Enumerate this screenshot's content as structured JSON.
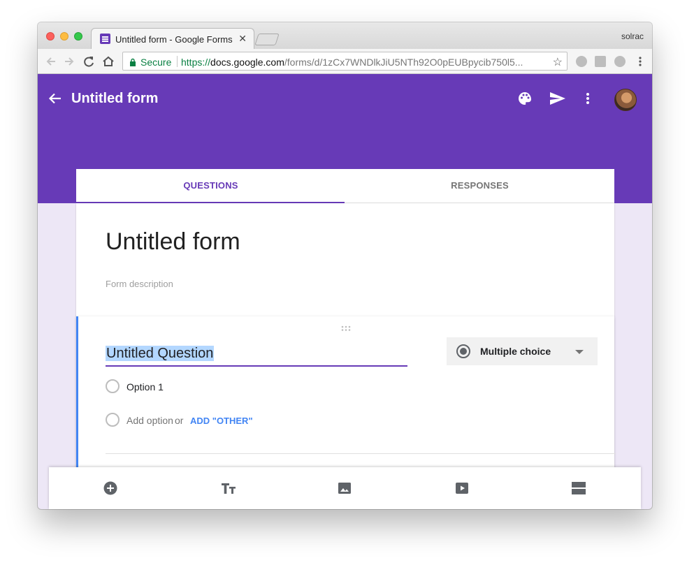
{
  "browser": {
    "tab_title": "Untitled form - Google Forms",
    "tab_close": "✕",
    "profile_name": "solrac",
    "secure_label": "Secure",
    "url_scheme": "https://",
    "url_host": "docs.google.com",
    "url_path": "/forms/d/1zCx7WNDlkJiU5NTh92O0pEUBpycib750l5..."
  },
  "header": {
    "form_title": "Untitled form",
    "icons": [
      "back-arrow-icon",
      "palette-icon",
      "send-icon",
      "more-vert-icon",
      "avatar"
    ],
    "brand_color": "#673ab7"
  },
  "tabs": [
    {
      "label": "QUESTIONS",
      "active": true
    },
    {
      "label": "RESPONSES",
      "active": false
    }
  ],
  "form": {
    "title": "Untitled form",
    "description_placeholder": "Form description"
  },
  "question": {
    "title": "Untitled Question",
    "type": "Multiple choice",
    "options": [
      "Option 1"
    ],
    "add_option": "Add option",
    "or": "or",
    "add_other": "ADD \"OTHER\""
  },
  "bottom_toolbar": {
    "icons": [
      "add-question-icon",
      "add-title-icon",
      "add-image-icon",
      "add-video-icon",
      "add-section-icon"
    ]
  }
}
